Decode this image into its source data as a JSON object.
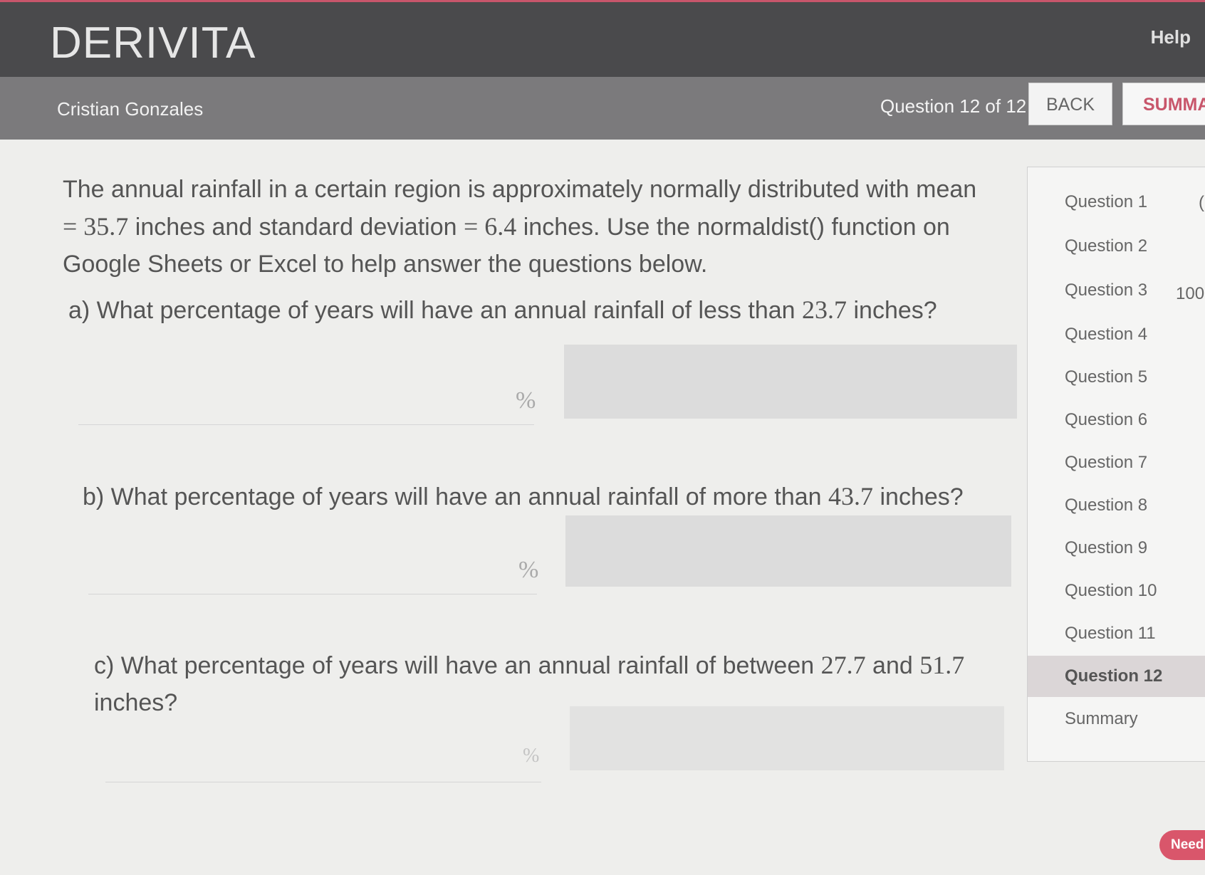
{
  "header": {
    "logo": "DERIVITA",
    "help_label": "Help"
  },
  "subheader": {
    "user_name": "Cristian Gonzales",
    "question_counter": "Question 12 of 12",
    "back_label": "BACK",
    "summary_label": "SUMMA"
  },
  "problem": {
    "stem_part1": "The annual rainfall in a certain region is approximately normally distributed with mean",
    "stem_eq1": "= 35.7",
    "stem_part2": " inches and standard deviation ",
    "stem_eq2": "= 6.4",
    "stem_part3": " inches. Use the normaldist() function on",
    "stem_part4": "Google Sheets or Excel to help answer the questions below.",
    "questions": [
      {
        "prefix": "a) What percentage of years will have an annual rainfall of less than ",
        "value": "23.7",
        "suffix": " inches?",
        "unit": "%"
      },
      {
        "prefix": "b) What percentage of years will have an annual rainfall of more than ",
        "value": "43.7",
        "suffix": " inches?",
        "unit": "%"
      },
      {
        "prefix": "c) What percentage of years will have an annual rainfall of between ",
        "value": "27.7",
        "mid": " and ",
        "value2": "51.7",
        "suffix": "inches?",
        "unit": "%"
      }
    ]
  },
  "sidebar": {
    "items": [
      "Question 1",
      "Question 2",
      "Question 3",
      "Question 4",
      "Question 5",
      "Question 6",
      "Question 7",
      "Question 8",
      "Question 9",
      "Question 10",
      "Question 11",
      "Question 12",
      "Summary"
    ],
    "active": "Question 12",
    "score_fragments": [
      "(",
      "100"
    ]
  },
  "need_help_label": "Need"
}
